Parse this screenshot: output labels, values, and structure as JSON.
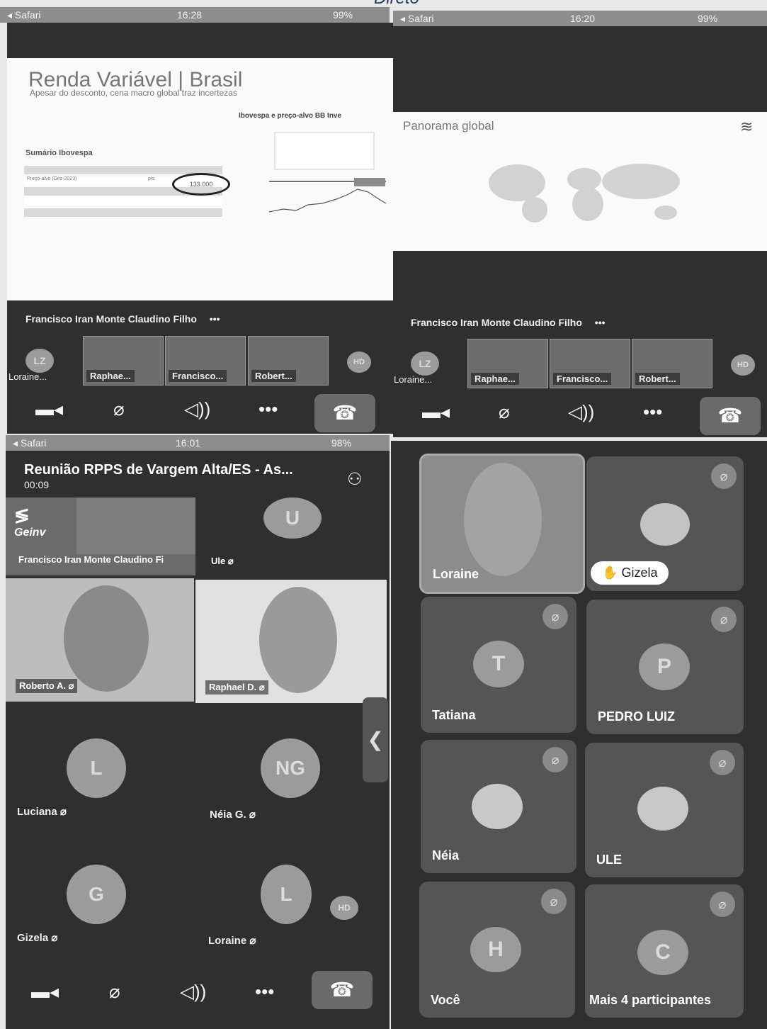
{
  "top_left": {
    "status": {
      "carrier": "◂ Safari",
      "time": "16:28",
      "battery": "99%"
    },
    "slide": {
      "title": "Renda Variável | Brasil",
      "subtitle": "Apesar do desconto, cena macro global traz incertezas",
      "chart_title": "Ibovespa e preço-alvo BB Inve",
      "summary_title": "Sumário Ibovespa",
      "row_label": "Preço-alvo (Dez-2023)",
      "row_unit": "pts",
      "target_value": "133.000"
    },
    "presenter_name": "Francisco Iran Monte Claudino Filho",
    "more_label": "•••",
    "thumbnails": [
      {
        "initials": "LZ",
        "label": "Loraine..."
      },
      {
        "label": "Raphae..."
      },
      {
        "label": "Francisco..."
      },
      {
        "label": "Robert..."
      },
      {
        "initials": "HD"
      }
    ]
  },
  "top_right": {
    "status": {
      "carrier": "◂ Safari",
      "time": "16:20",
      "battery": "99%"
    },
    "slide": {
      "title": "Panorama global"
    },
    "presenter_name": "Francisco Iran Monte Claudino Filho",
    "more_label": "•••",
    "thumbnails": [
      {
        "initials": "LZ",
        "label": "Loraine..."
      },
      {
        "label": "Raphae..."
      },
      {
        "label": "Francisco..."
      },
      {
        "label": "Robert..."
      },
      {
        "initials": "HD"
      }
    ]
  },
  "header_handwriting": "Direto",
  "bottom_left": {
    "status": {
      "carrier": "◂ Safari",
      "time": "16:01",
      "battery": "98%"
    },
    "meeting_title": "Reunião RPPS de Vargem Alta/ES - As...",
    "elapsed": "00:09",
    "logo_text": "Geinv",
    "video_tiles": [
      {
        "name": "Francisco Iran Monte Claudino Fi"
      },
      {
        "name": "Ule",
        "initial": "U"
      },
      {
        "name": "Roberto A."
      },
      {
        "name": "Raphael D."
      }
    ],
    "grid": [
      {
        "name": "Luciana",
        "initial": "L"
      },
      {
        "name": "Néia G.",
        "initial": "NG"
      },
      {
        "name": "Gizela",
        "initial": "G"
      },
      {
        "name": "Loraine",
        "initial": "L"
      }
    ],
    "hd_badge": "HD"
  },
  "bottom_right": {
    "tiles": [
      {
        "name": "Loraine"
      },
      {
        "name": "Gizela",
        "raised_hand": true
      },
      {
        "name": "Tatiana",
        "initial": "T"
      },
      {
        "name": "PEDRO LUIZ",
        "initial": "P"
      },
      {
        "name": "Néia"
      },
      {
        "name": "ULE"
      },
      {
        "name": "Você",
        "initial": "H"
      },
      {
        "name": "Mais 4 participantes",
        "initial": "C"
      }
    ]
  },
  "colors": {
    "dark_bg": "#2f2f2f",
    "tile_bg": "#555555",
    "status_bg": "#8d8d8d"
  }
}
